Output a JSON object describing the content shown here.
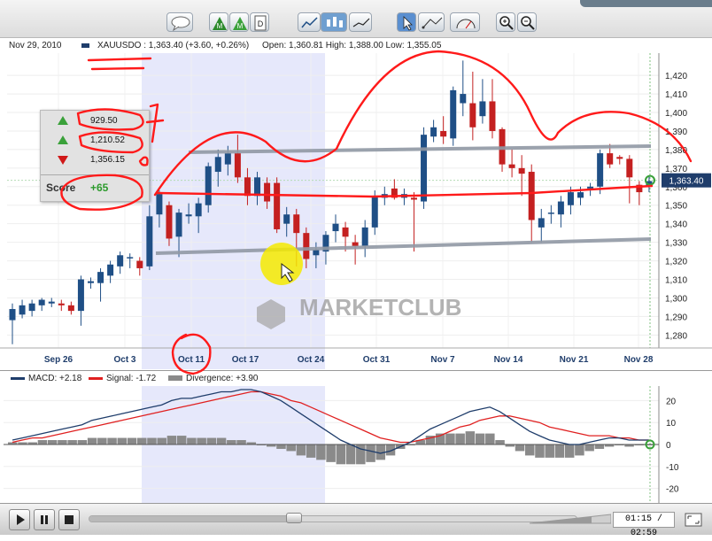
{
  "toolbar": {
    "buttons": [
      "chat-bubble-icon",
      "marketclub-triangle-icon",
      "marketclub-triangle-icon",
      "document-icon",
      "bar-chart-icon",
      "candlestick-icon",
      "line-chart-icon",
      "pointer-icon",
      "draw-line-icon",
      "gauge-icon",
      "zoom-in-icon",
      "zoom-out-icon"
    ]
  },
  "info": {
    "date": "Nov 29, 2010",
    "symbol_line": "XAUUSDO : 1,363.40 (+3.60, +0.26%)",
    "ohlc": "Open: 1,360.81  High: 1,388.00  Low: 1,355.05"
  },
  "chart_data": {
    "type": "candlestick",
    "y_ticks": [
      "1,420",
      "1,410",
      "1,400",
      "1,390",
      "1,380",
      "1,370",
      "1,360",
      "1,350",
      "1,340",
      "1,330",
      "1,320",
      "1,310",
      "1,300",
      "1,290",
      "1,280"
    ],
    "x_labels": [
      "Sep 26",
      "Oct 3",
      "Oct 11",
      "Oct 17",
      "Oct 24",
      "Oct 31",
      "Nov 7",
      "Nov 14",
      "Nov 21",
      "Nov 28"
    ],
    "last_price": "1,363.40",
    "ylim": [
      1273,
      1432
    ],
    "candles": [
      [
        1288,
        1294,
        1275,
        1297
      ],
      [
        1291,
        1296,
        1289,
        1299
      ],
      [
        1293,
        1297,
        1290,
        1299
      ],
      [
        1296,
        1299,
        1293,
        1300
      ],
      [
        1297,
        1298,
        1295,
        1300
      ],
      [
        1297,
        1296,
        1293,
        1299
      ],
      [
        1296,
        1293,
        1291,
        1298
      ],
      [
        1293,
        1310,
        1285,
        1312
      ],
      [
        1308,
        1309,
        1305,
        1311
      ],
      [
        1308,
        1314,
        1298,
        1316
      ],
      [
        1312,
        1318,
        1308,
        1320
      ],
      [
        1317,
        1323,
        1313,
        1325
      ],
      [
        1322,
        1322,
        1316,
        1324
      ],
      [
        1320,
        1316,
        1312,
        1322
      ],
      [
        1317,
        1344,
        1315,
        1350
      ],
      [
        1345,
        1356,
        1338,
        1358
      ],
      [
        1350,
        1332,
        1328,
        1352
      ],
      [
        1333,
        1346,
        1322,
        1348
      ],
      [
        1344,
        1345,
        1340,
        1351
      ],
      [
        1344,
        1351,
        1335,
        1354
      ],
      [
        1350,
        1371,
        1346,
        1373
      ],
      [
        1368,
        1376,
        1360,
        1380
      ],
      [
        1372,
        1378,
        1366,
        1382
      ],
      [
        1378,
        1365,
        1362,
        1388
      ],
      [
        1365,
        1355,
        1350,
        1370
      ],
      [
        1355,
        1365,
        1350,
        1368
      ],
      [
        1362,
        1352,
        1348,
        1365
      ],
      [
        1362,
        1337,
        1335,
        1365
      ],
      [
        1340,
        1345,
        1333,
        1349
      ],
      [
        1345,
        1335,
        1317,
        1348
      ],
      [
        1335,
        1321,
        1316,
        1338
      ],
      [
        1323,
        1326,
        1316,
        1330
      ],
      [
        1325,
        1334,
        1318,
        1336
      ],
      [
        1336,
        1340,
        1330,
        1345
      ],
      [
        1338,
        1333,
        1325,
        1341
      ],
      [
        1330,
        1328,
        1318,
        1334
      ],
      [
        1328,
        1338,
        1322,
        1342
      ],
      [
        1338,
        1355,
        1334,
        1358
      ],
      [
        1354,
        1356,
        1350,
        1360
      ],
      [
        1359,
        1354,
        1353,
        1364
      ],
      [
        1354,
        1356,
        1350,
        1359
      ],
      [
        1354,
        1353,
        1325,
        1357
      ],
      [
        1352,
        1388,
        1348,
        1392
      ],
      [
        1387,
        1392,
        1384,
        1396
      ],
      [
        1390,
        1387,
        1383,
        1398
      ],
      [
        1386,
        1412,
        1382,
        1414
      ],
      [
        1405,
        1410,
        1398,
        1428
      ],
      [
        1405,
        1392,
        1385,
        1422
      ],
      [
        1398,
        1406,
        1394,
        1418
      ],
      [
        1406,
        1390,
        1386,
        1418
      ],
      [
        1391,
        1372,
        1368,
        1392
      ],
      [
        1372,
        1370,
        1365,
        1380
      ],
      [
        1370,
        1367,
        1355,
        1377
      ],
      [
        1368,
        1342,
        1330,
        1372
      ],
      [
        1338,
        1343,
        1330,
        1348
      ],
      [
        1346,
        1346,
        1340,
        1350
      ],
      [
        1345,
        1352,
        1338,
        1355
      ],
      [
        1350,
        1357,
        1345,
        1360
      ],
      [
        1354,
        1357,
        1350,
        1360
      ],
      [
        1359,
        1360,
        1355,
        1362
      ],
      [
        1360,
        1378,
        1356,
        1380
      ],
      [
        1378,
        1372,
        1370,
        1383
      ],
      [
        1376,
        1375,
        1372,
        1377
      ],
      [
        1375,
        1365,
        1351,
        1377
      ],
      [
        1361,
        1357,
        1350,
        1363
      ],
      [
        1360,
        1363,
        1357,
        1366
      ]
    ],
    "macd_ticks": [
      "20",
      "10",
      "0",
      "-10",
      "-20"
    ],
    "macd_ylim": [
      -25,
      25
    ],
    "macd": [
      2,
      3,
      4,
      5,
      6,
      7,
      8,
      9,
      11,
      12,
      13,
      14,
      15,
      16,
      17,
      18,
      20,
      21,
      21,
      22,
      23,
      24,
      24,
      25,
      25,
      24,
      22,
      20,
      17,
      14,
      11,
      8,
      5,
      2,
      0,
      -2,
      -3,
      -4,
      -3,
      -1,
      1,
      4,
      7,
      9,
      11,
      13,
      15,
      16,
      17,
      15,
      12,
      9,
      6,
      4,
      2,
      1,
      0,
      0,
      1,
      2,
      3,
      3,
      2,
      2,
      2
    ],
    "signal": [
      1,
      2,
      3,
      3,
      4,
      5,
      6,
      7,
      8,
      9,
      10,
      11,
      12,
      13,
      14,
      15,
      16,
      17,
      18,
      19,
      20,
      21,
      22,
      23,
      24,
      24,
      23,
      22,
      20,
      19,
      17,
      15,
      13,
      11,
      9,
      7,
      5,
      3,
      2,
      1,
      1,
      2,
      3,
      4,
      6,
      8,
      9,
      11,
      12,
      13,
      13,
      12,
      11,
      10,
      8,
      7,
      6,
      5,
      4,
      4,
      4,
      3,
      3,
      2,
      2
    ],
    "divergence": [
      1,
      1,
      1,
      2,
      2,
      2,
      2,
      2,
      3,
      3,
      3,
      3,
      3,
      3,
      3,
      3,
      4,
      4,
      3,
      3,
      3,
      3,
      2,
      2,
      1,
      0,
      -1,
      -2,
      -3,
      -5,
      -6,
      -7,
      -8,
      -9,
      -9,
      -9,
      -8,
      -7,
      -5,
      -2,
      0,
      2,
      4,
      5,
      5,
      5,
      6,
      5,
      5,
      2,
      -1,
      -3,
      -5,
      -6,
      -6,
      -6,
      -6,
      -5,
      -3,
      -2,
      -1,
      0,
      -1,
      0,
      0
    ]
  },
  "macd_legend": {
    "macd": "MACD: +2.18",
    "signal": "Signal: -1.72",
    "divergence": "Divergence: +3.90"
  },
  "colors": {
    "up": "#1f4f86",
    "down": "#c42020",
    "annotation": "#ff1a1a",
    "highlight": "#e6e8fb",
    "macd_line": "#1f3d6b",
    "signal_line": "#e02020",
    "divergence_bar": "#8a8a8a"
  },
  "score_box": {
    "row1": "929.50",
    "row2": "1,210.52",
    "row3": "1,356.15",
    "label": "Score",
    "value": "+65"
  },
  "watermark": "MARKETCLUB",
  "player": {
    "time": "01:15 / 02:59",
    "progress": 0.42
  }
}
